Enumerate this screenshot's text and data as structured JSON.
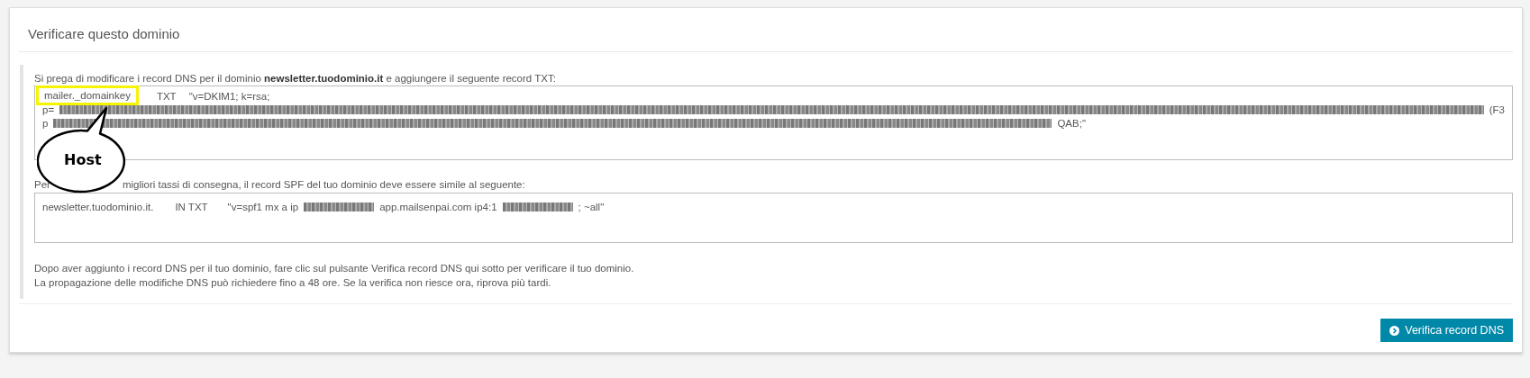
{
  "panel": {
    "title": "Verificare questo dominio"
  },
  "dkim": {
    "intro": "Si prega di modificare i record DNS per il dominio **newsletter.tuodominio.it** e aggiungere il seguente record TXT:",
    "host": "mailer._domainkey",
    "host_highlighted": true,
    "type": "TXT",
    "value": "\"v=DKIM1; k=rsa;",
    "lines": [
      {
        "prefix": "p=",
        "suffix": "(F3"
      },
      {
        "prefix": "p",
        "suffix": "QAB;\""
      }
    ]
  },
  "callout": {
    "label": "Host"
  },
  "spf": {
    "intro_parts": [
      "Per",
      "migliori tassi di consegna, il record SPF del tuo dominio deve essere simile al seguente:"
    ],
    "host": "newsletter.tuodominio.it.",
    "type": "IN TXT",
    "segments": [
      {
        "kind": "text",
        "text": "\"v=spf1 mx a ip"
      },
      {
        "kind": "redacted"
      },
      {
        "kind": "text",
        "text": "app.mailsenpai.com ip4:1"
      },
      {
        "kind": "redacted"
      },
      {
        "kind": "text",
        "text": "; ~all\""
      }
    ]
  },
  "notes": [
    "Dopo aver aggiunto i record DNS per il tuo dominio, fare clic sul pulsante Verifica record DNS qui sotto per verificare il tuo dominio.",
    "La propagazione delle modifiche DNS può richiedere fino a 48 ore. Se la verifica non riesce ora, riprova più tardi."
  ],
  "button": {
    "label": "Verifica record DNS"
  }
}
